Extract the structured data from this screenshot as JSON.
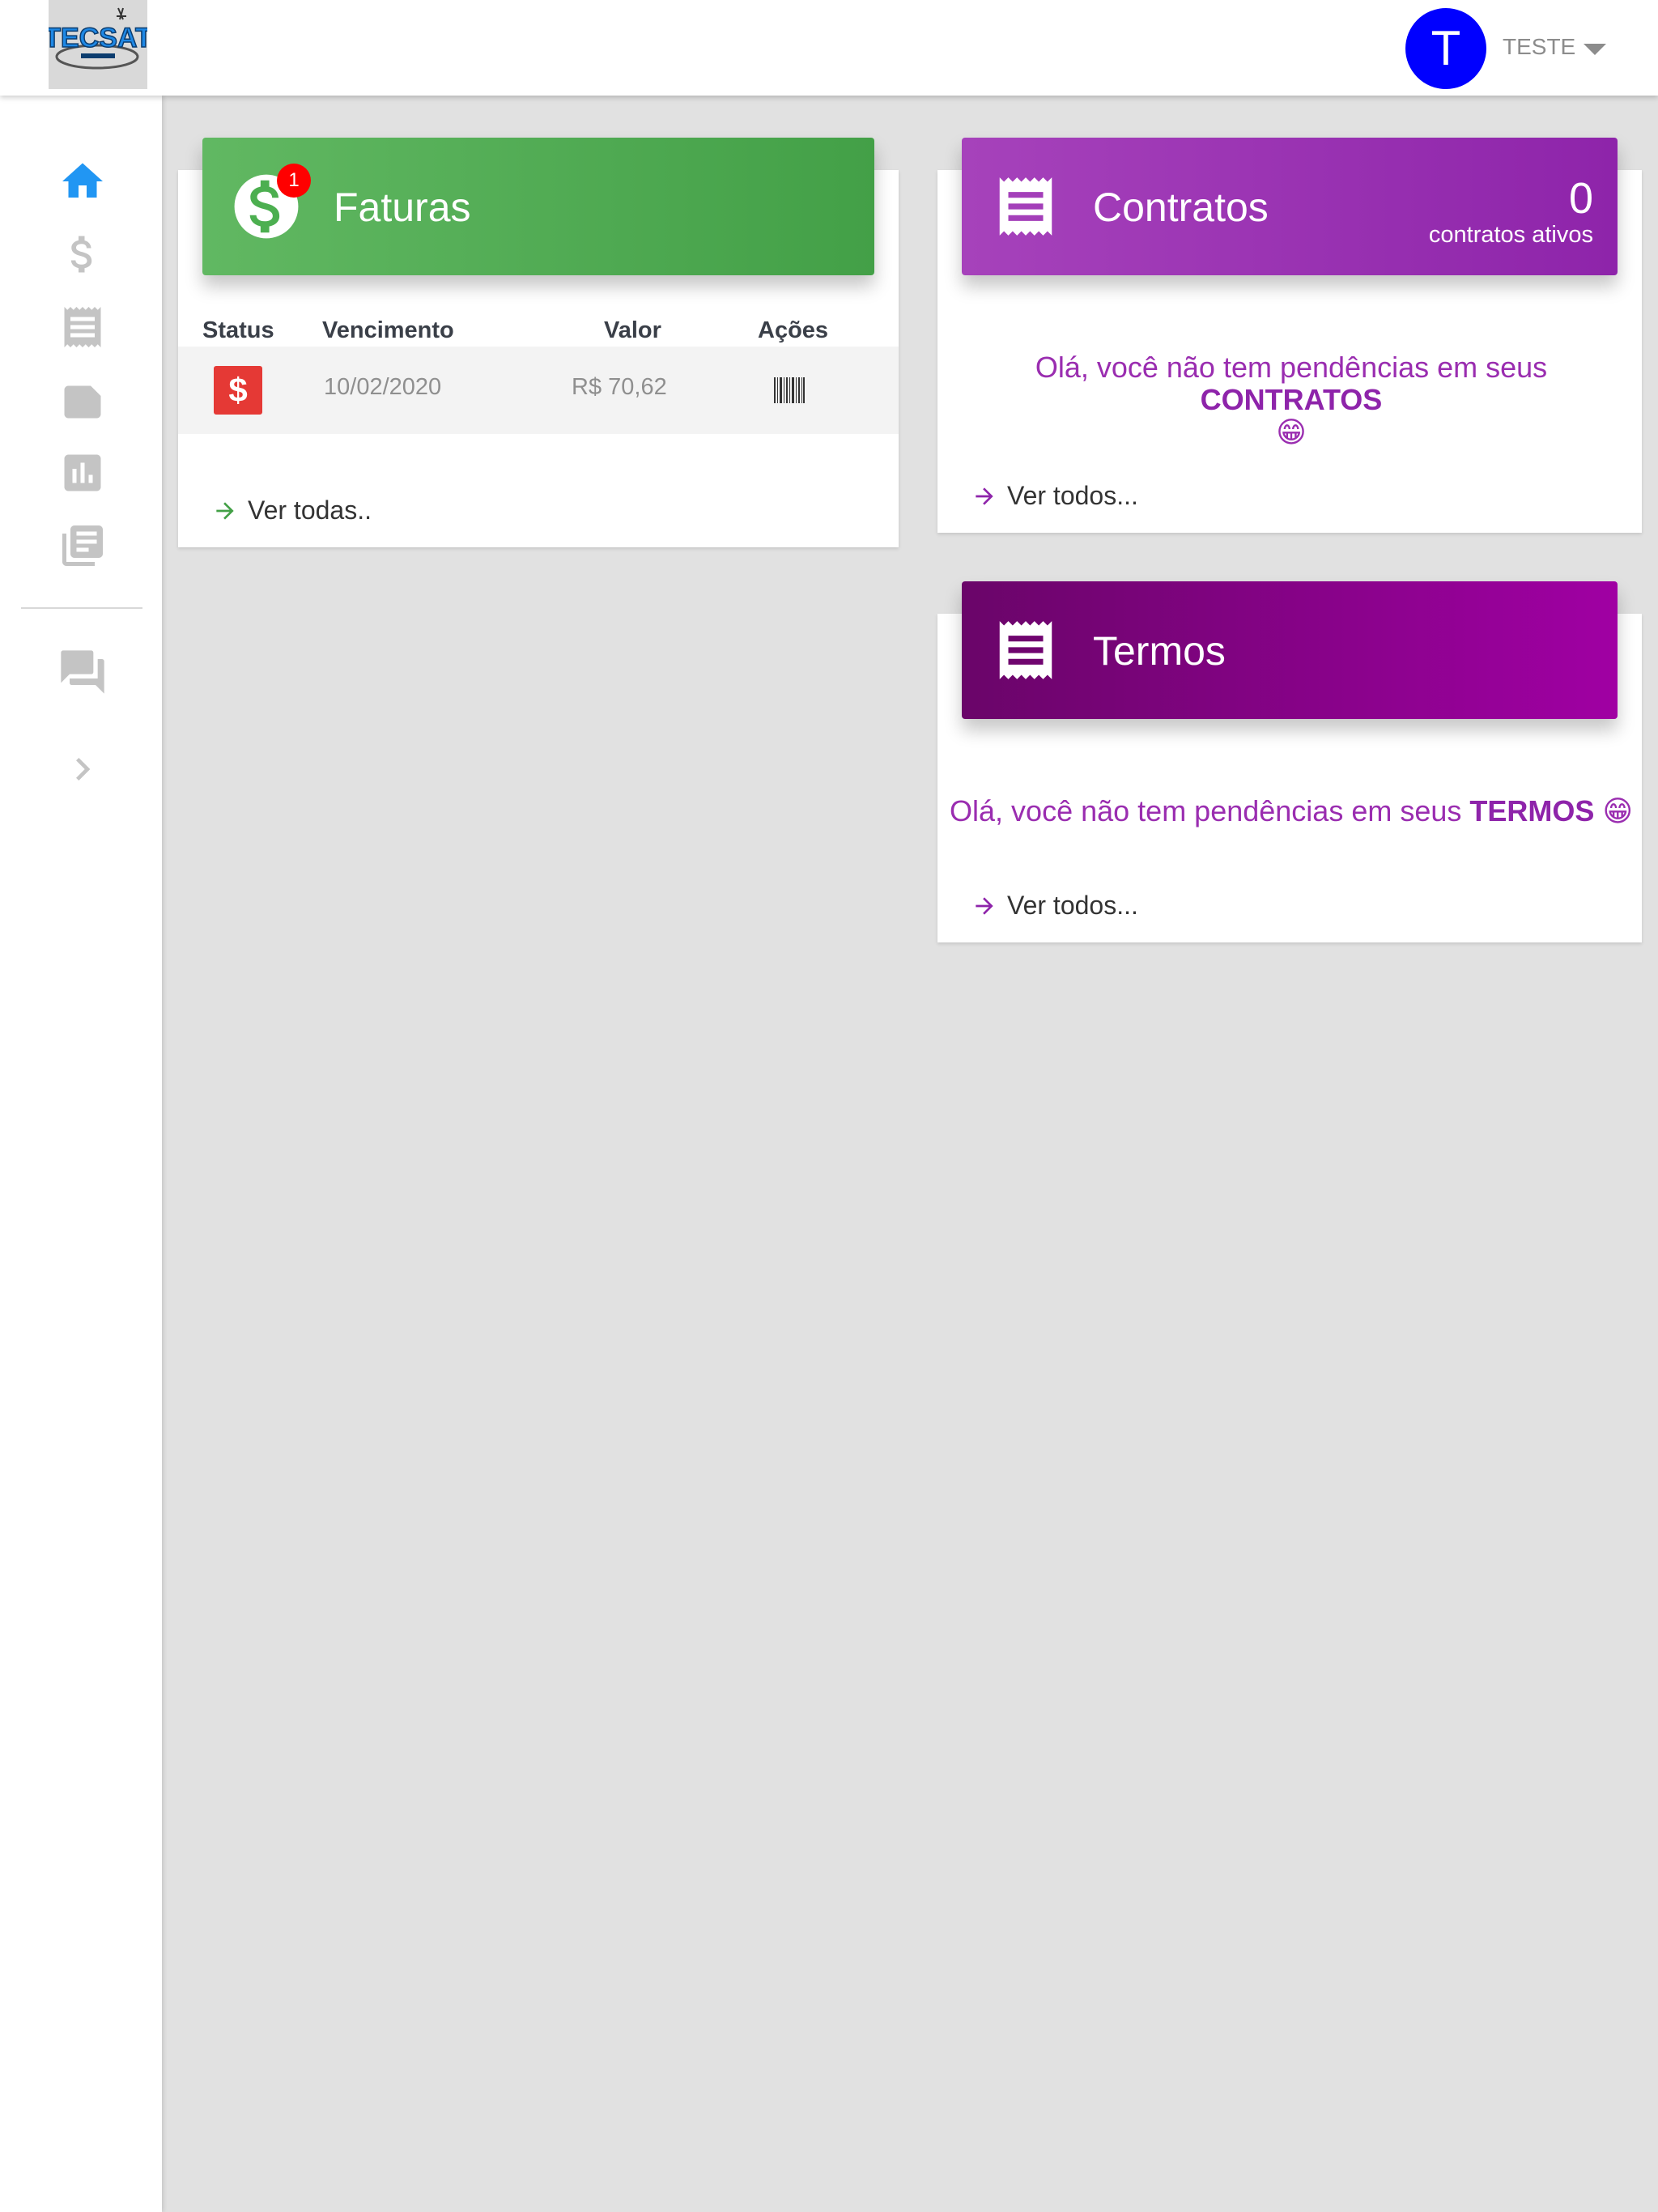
{
  "header": {
    "logo_text": "TECSAT",
    "avatar_initial": "T",
    "user_name": "TESTE"
  },
  "sidebar": {
    "items": [
      {
        "icon": "home-icon",
        "active": true
      },
      {
        "icon": "dollar-icon"
      },
      {
        "icon": "receipt-icon"
      },
      {
        "icon": "label-icon"
      },
      {
        "icon": "chart-icon"
      },
      {
        "icon": "library-books-icon"
      },
      {
        "icon": "forum-icon"
      },
      {
        "icon": "chevron-right-icon"
      }
    ]
  },
  "faturas": {
    "title": "Faturas",
    "badge": "1",
    "columns": [
      "Status",
      "Vencimento",
      "Valor",
      "Ações"
    ],
    "rows": [
      {
        "status_icon": "$",
        "vencimento": "10/02/2020",
        "valor": "R$ 70,62",
        "acao_icon": "barcode-icon"
      }
    ],
    "link": "Ver todas.."
  },
  "contratos": {
    "title": "Contratos",
    "count": "0",
    "count_label": "contratos ativos",
    "message_prefix": "Olá, você não tem pendências em seus",
    "message_highlight": "CONTRATOS",
    "emoji": "😁",
    "link": "Ver todos..."
  },
  "termos": {
    "title": "Termos",
    "message_prefix": "Olá, você não tem pendências em seus",
    "message_highlight": "TERMOS",
    "emoji": "😁",
    "link": "Ver todos..."
  },
  "colors": {
    "green": "#43a047",
    "purple": "#8e24aa",
    "dark_purple": "#7b0a80",
    "blue_active": "#2196f3",
    "alert_red": "#e53935",
    "avatar_blue": "#0000ff"
  }
}
